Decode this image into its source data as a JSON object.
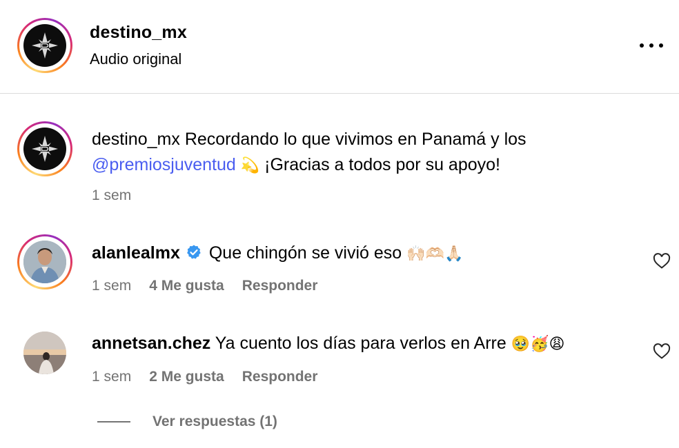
{
  "header": {
    "username": "destino_mx",
    "subtitle": "Audio original"
  },
  "caption": {
    "username": "destino_mx",
    "text_part1": "Recordando lo que vivimos en Panamá y los",
    "mention": "@premiosjuventud",
    "emoji": "💫",
    "text_part2": "¡Gracias a todos por su apoyo!",
    "time": "1 sem"
  },
  "comments": [
    {
      "username": "alanlealmx",
      "verified": true,
      "text": "Que chingón se vivió eso",
      "emoji": "🙌🏻🫶🏻🙏🏻",
      "time": "1 sem",
      "likes": "4 Me gusta",
      "reply_label": "Responder"
    },
    {
      "username": "annetsan.chez",
      "verified": false,
      "text": "Ya cuento los días para verlos en Arre",
      "emoji": "🥹🥳😩",
      "time": "1 sem",
      "likes": "2 Me gusta",
      "reply_label": "Responder",
      "view_replies": "Ver respuestas (1)"
    }
  ],
  "colors": {
    "mention": "#4a5df0",
    "meta": "#737373",
    "verified": "#3897f0"
  },
  "icons": [
    "more-options-icon",
    "verified-badge-icon",
    "heart-icon",
    "star-logo-icon"
  ]
}
